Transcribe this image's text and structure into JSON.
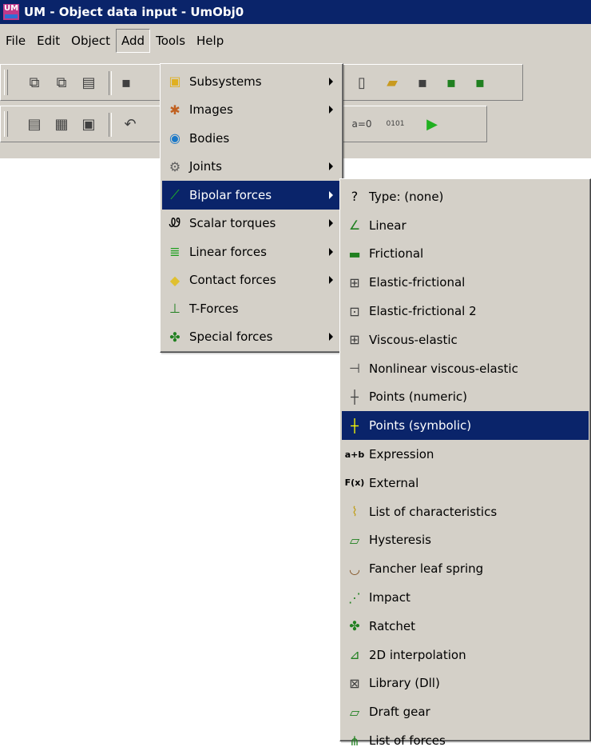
{
  "window": {
    "title": "UM - Object data input - UmObj0",
    "app_icon_text": "UM"
  },
  "menubar": {
    "items": [
      "File",
      "Edit",
      "Object",
      "Add",
      "Tools",
      "Help"
    ],
    "open": "Add"
  },
  "add_menu": {
    "items": [
      {
        "label": "Subsystems",
        "icon": "subsystems-icon",
        "glyph": "▣",
        "color": "#e0b020",
        "submenu": true
      },
      {
        "label": "Images",
        "icon": "images-icon",
        "glyph": "✱",
        "color": "#c06020",
        "submenu": true
      },
      {
        "label": "Bodies",
        "icon": "bodies-icon",
        "glyph": "◉",
        "color": "#1a78c8",
        "submenu": false
      },
      {
        "label": "Joints",
        "icon": "joints-icon",
        "glyph": "⚙",
        "color": "#606060",
        "submenu": true
      },
      {
        "label": "Bipolar forces",
        "icon": "bipolar-forces-icon",
        "glyph": "⟋",
        "color": "#20a020",
        "submenu": true,
        "selected": true
      },
      {
        "label": "Scalar torques",
        "icon": "scalar-torques-icon",
        "glyph": "Ꮺ",
        "color": "#000000",
        "submenu": true
      },
      {
        "label": "Linear forces",
        "icon": "linear-forces-icon",
        "glyph": "≣",
        "color": "#20a020",
        "submenu": true
      },
      {
        "label": "Contact forces",
        "icon": "contact-forces-icon",
        "glyph": "◆",
        "color": "#e0c030",
        "submenu": true
      },
      {
        "label": "T-Forces",
        "icon": "t-forces-icon",
        "glyph": "⊥",
        "color": "#208020",
        "submenu": false
      },
      {
        "label": "Special forces",
        "icon": "special-forces-icon",
        "glyph": "✤",
        "color": "#208020",
        "submenu": true
      }
    ]
  },
  "bipolar_menu": {
    "items": [
      {
        "label": "Type: (none)",
        "icon": "question-icon",
        "glyph": "?",
        "color": "#000000"
      },
      {
        "label": "Linear",
        "icon": "linear-icon",
        "glyph": "∠",
        "color": "#208020"
      },
      {
        "label": "Frictional",
        "icon": "frictional-icon",
        "glyph": "▬",
        "color": "#208020"
      },
      {
        "label": "Elastic-frictional",
        "icon": "elastic-frictional-icon",
        "glyph": "⊞",
        "color": "#404040"
      },
      {
        "label": "Elastic-frictional 2",
        "icon": "elastic-frictional-2-icon",
        "glyph": "⊡",
        "color": "#404040"
      },
      {
        "label": "Viscous-elastic",
        "icon": "viscous-elastic-icon",
        "glyph": "⊞",
        "color": "#404040"
      },
      {
        "label": "Nonlinear viscous-elastic",
        "icon": "nonlinear-viscous-elastic-icon",
        "glyph": "⊣",
        "color": "#404040"
      },
      {
        "label": "Points (numeric)",
        "icon": "points-numeric-icon",
        "glyph": "┼",
        "color": "#404040"
      },
      {
        "label": "Points (symbolic)",
        "icon": "points-symbolic-icon",
        "glyph": "┼",
        "color": "#ffff00",
        "selected": true
      },
      {
        "label": "Expression",
        "icon": "expression-icon",
        "glyph": "a+b",
        "color": "#000000"
      },
      {
        "label": "External",
        "icon": "external-icon",
        "glyph": "F(x)",
        "color": "#000000"
      },
      {
        "label": "List of characteristics",
        "icon": "list-of-characteristics-icon",
        "glyph": "⌇",
        "color": "#c0a020"
      },
      {
        "label": "Hysteresis",
        "icon": "hysteresis-icon",
        "glyph": "▱",
        "color": "#208020"
      },
      {
        "label": "Fancher leaf spring",
        "icon": "leaf-spring-icon",
        "glyph": "◡",
        "color": "#805020"
      },
      {
        "label": "Impact",
        "icon": "impact-icon",
        "glyph": "⋰",
        "color": "#208020"
      },
      {
        "label": "Ratchet",
        "icon": "ratchet-icon",
        "glyph": "✤",
        "color": "#208020"
      },
      {
        "label": "2D interpolation",
        "icon": "interpolation-2d-icon",
        "glyph": "⊿",
        "color": "#208020"
      },
      {
        "label": "Library (Dll)",
        "icon": "library-dll-icon",
        "glyph": "⊠",
        "color": "#404040"
      },
      {
        "label": "Draft gear",
        "icon": "draft-gear-icon",
        "glyph": "▱",
        "color": "#208020"
      },
      {
        "label": "List of forces",
        "icon": "list-of-forces-icon",
        "glyph": "⋔",
        "color": "#208020"
      }
    ]
  },
  "toolbar1": [
    {
      "icon": "copy-icon",
      "glyph": "⧉"
    },
    {
      "icon": "copy-all-icon",
      "glyph": "⧉"
    },
    {
      "icon": "paste-icon",
      "glyph": "▤"
    },
    {
      "icon": "save-icon",
      "glyph": "▪"
    },
    {
      "icon": "new-file-icon",
      "glyph": "▯"
    },
    {
      "icon": "open-folder-icon",
      "glyph": "▰"
    },
    {
      "icon": "save-gray-icon",
      "glyph": "▪"
    },
    {
      "icon": "save-green-icon",
      "glyph": "▪"
    },
    {
      "icon": "save-all-icon",
      "glyph": "▪"
    }
  ],
  "toolbar2": [
    {
      "icon": "list-window-icon",
      "glyph": "▤"
    },
    {
      "icon": "calculator-icon",
      "glyph": "▦"
    },
    {
      "icon": "screen-icon",
      "glyph": "▣"
    },
    {
      "icon": "undo-icon",
      "glyph": "↶"
    },
    {
      "icon": "assign-zero-icon",
      "glyph": "a=0"
    },
    {
      "icon": "binary-icon",
      "glyph": "0101"
    },
    {
      "icon": "run-icon",
      "glyph": "▶"
    }
  ]
}
